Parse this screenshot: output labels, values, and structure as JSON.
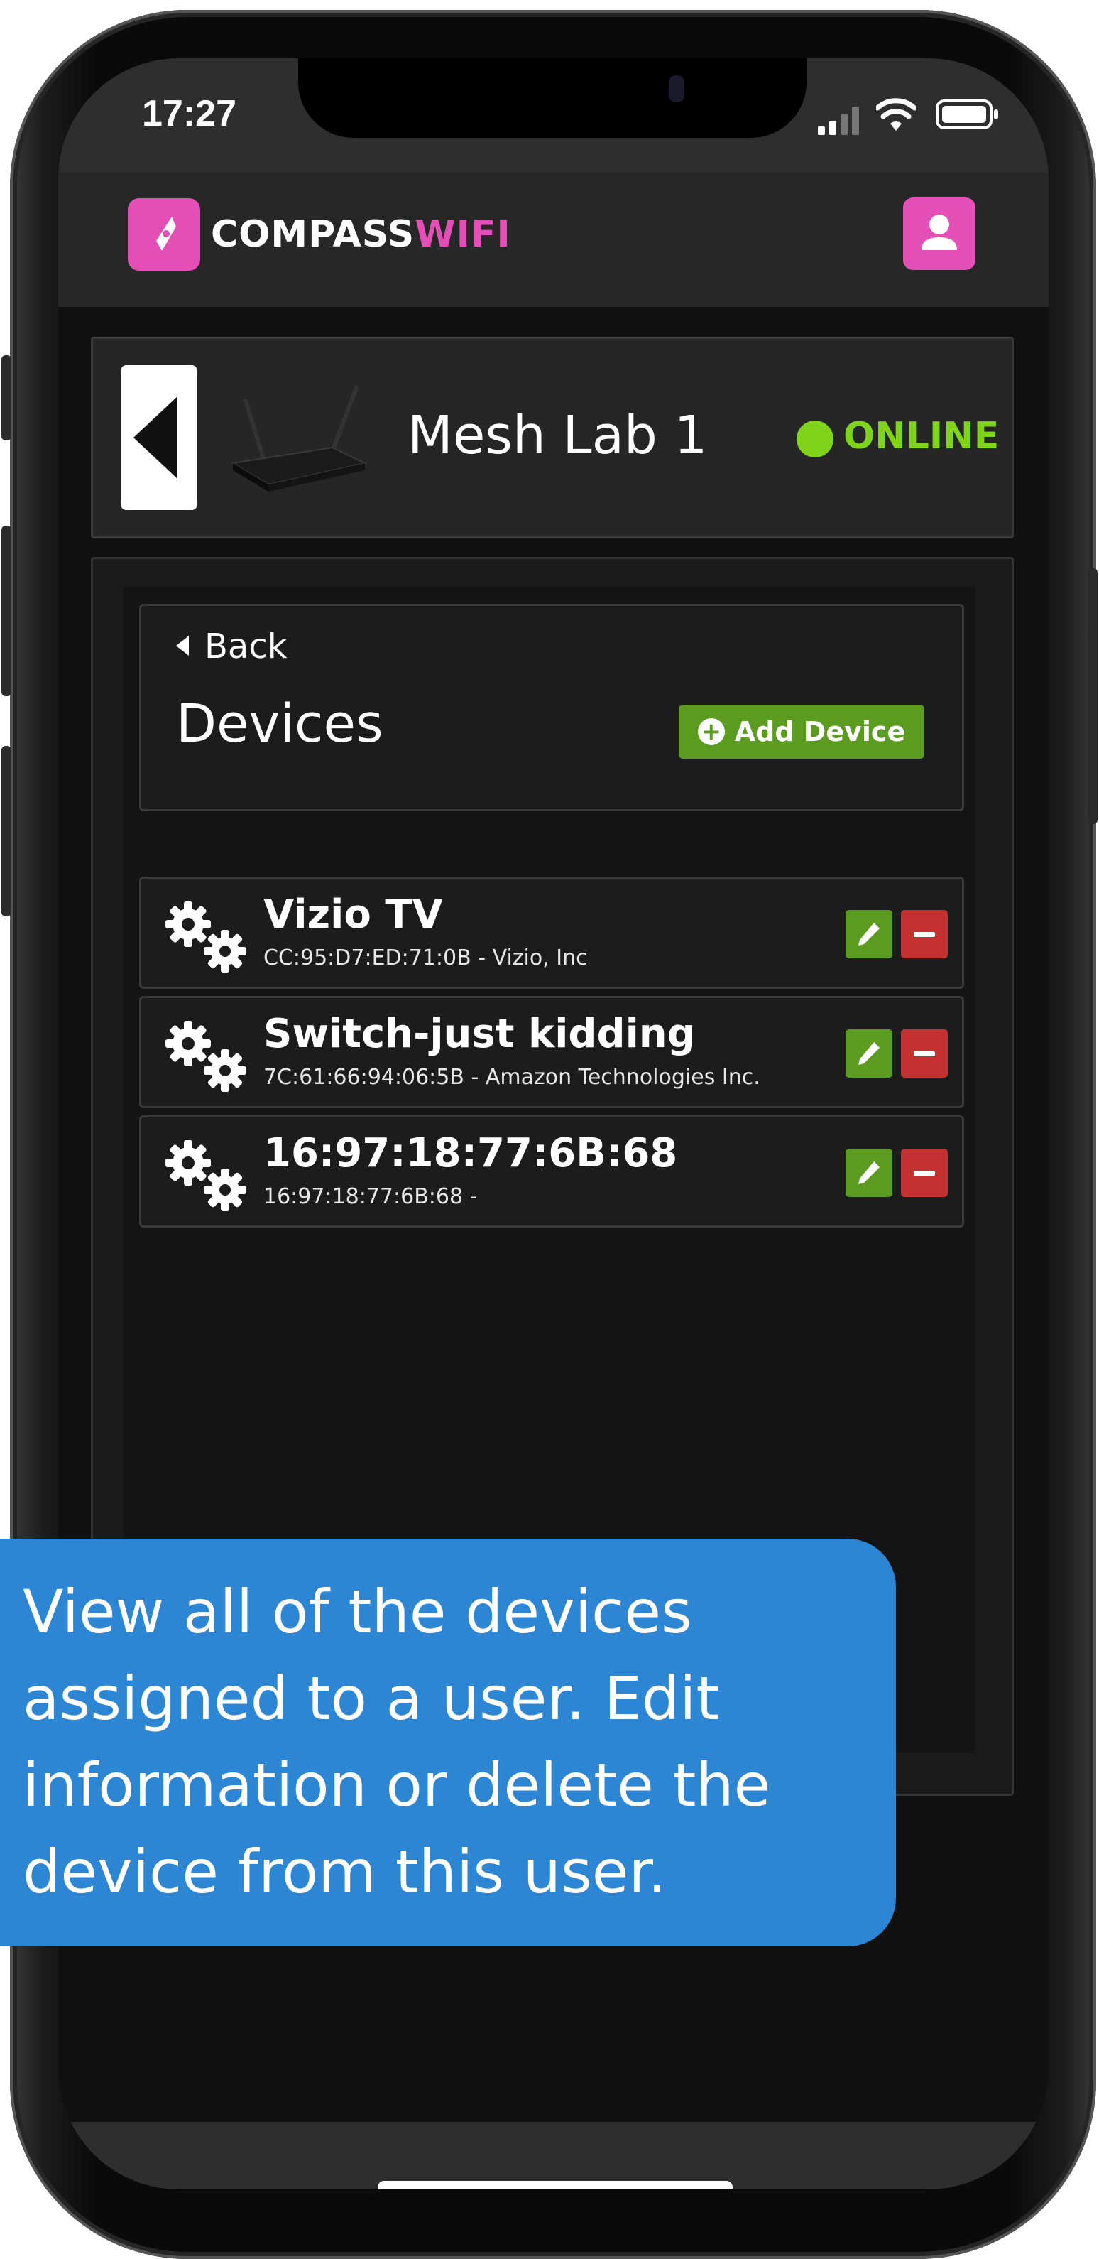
{
  "status_bar": {
    "time": "17:27"
  },
  "header": {
    "brand_primary": "COMPASS",
    "brand_accent": "WIFI",
    "accent_color": "#e44fb7"
  },
  "router": {
    "name": "Mesh Lab 1",
    "status": "ONLINE",
    "status_color": "#7fd41b"
  },
  "devices_panel": {
    "back_label": "Back",
    "title": "Devices",
    "add_button_label": "Add Device",
    "items": [
      {
        "name": "Vizio TV",
        "detail": "CC:95:D7:ED:71:0B - Vizio, Inc"
      },
      {
        "name": "Switch-just kidding",
        "detail": "7C:61:66:94:06:5B - Amazon Technologies Inc."
      },
      {
        "name": "16:97:18:77:6B:68",
        "detail": "16:97:18:77:6B:68 -"
      }
    ]
  },
  "callout": {
    "text": "View all of the devices assigned to a user. Edit information or delete the device from this user."
  },
  "icons": {
    "logo": "compass-needle-icon",
    "user": "user-icon",
    "gears": "gears-icon",
    "edit": "pencil-icon",
    "delete": "minus-icon"
  }
}
